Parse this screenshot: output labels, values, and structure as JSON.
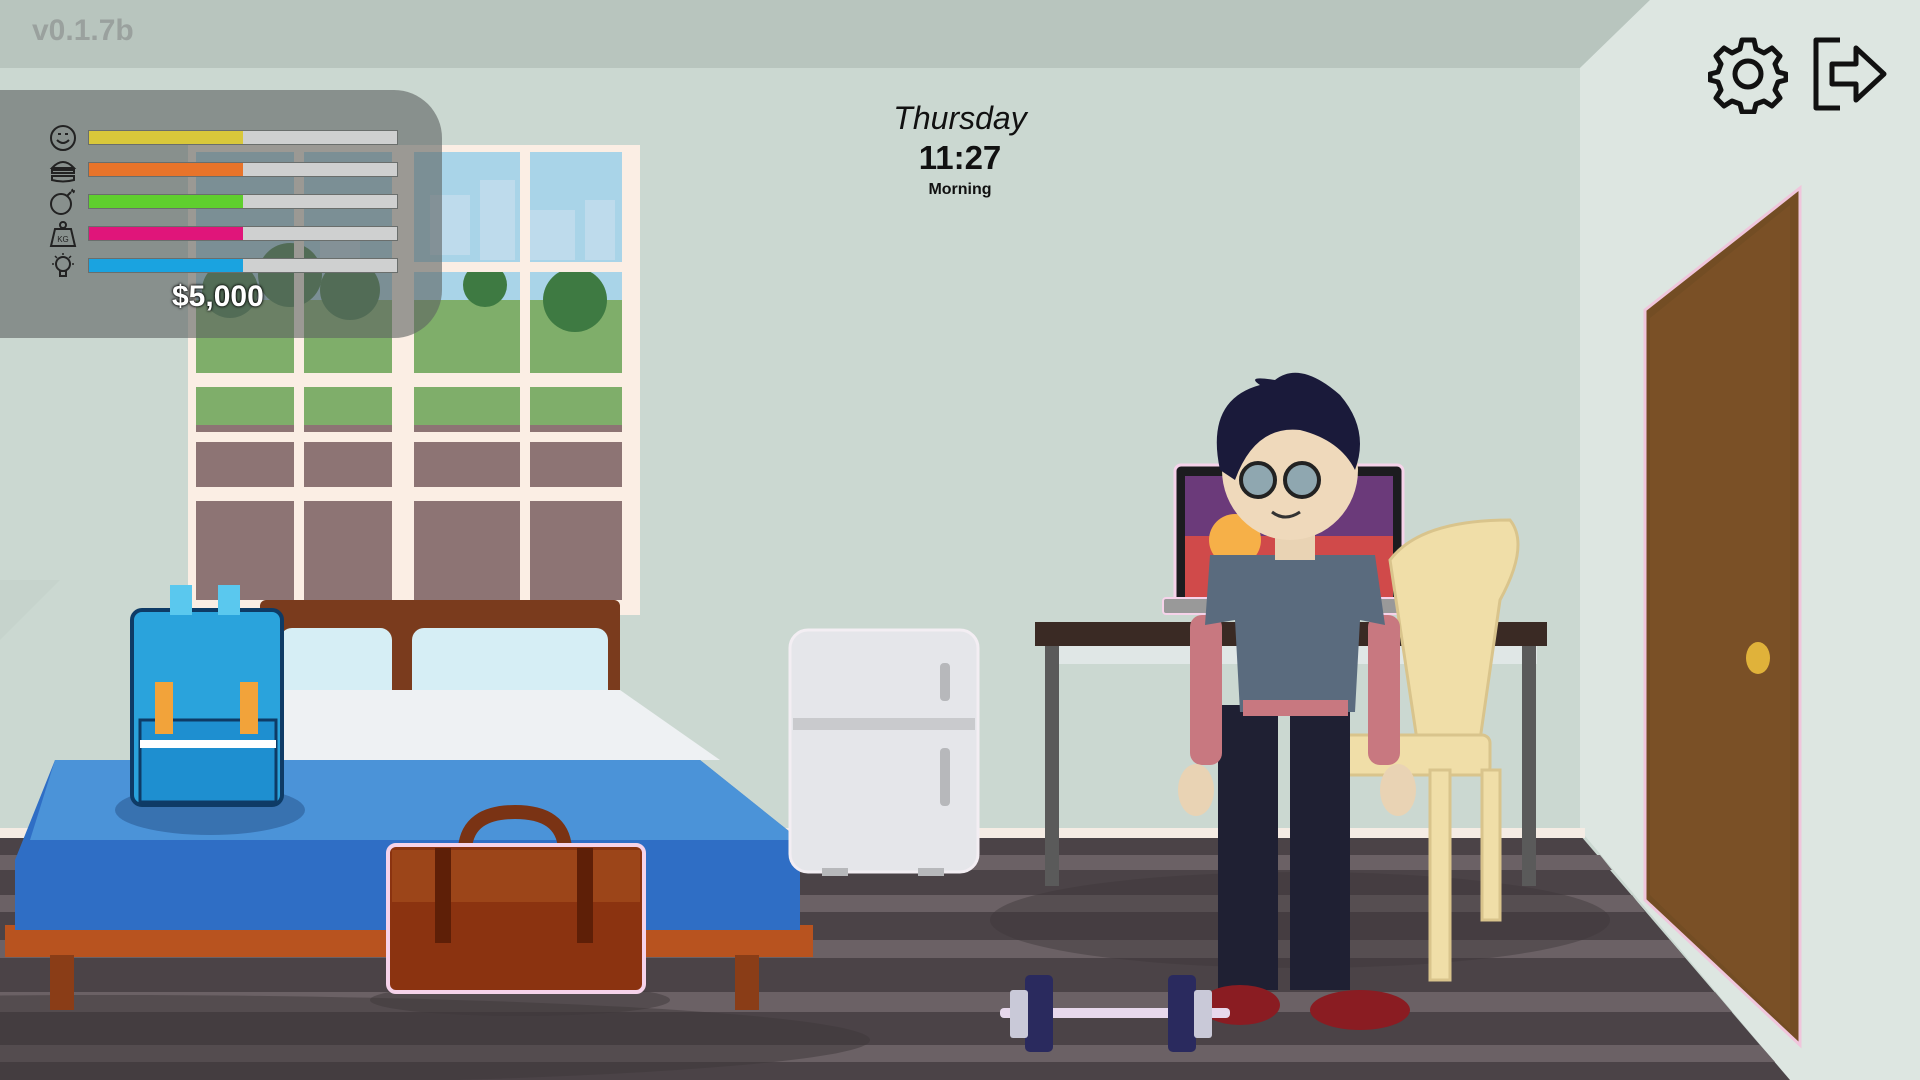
{
  "version": "v0.1.7b",
  "stats": [
    {
      "icon": "smiley-icon",
      "color": "#d9c83a",
      "value": 0.5
    },
    {
      "icon": "burger-icon",
      "color": "#e8742a",
      "value": 0.5
    },
    {
      "icon": "bomb-icon",
      "color": "#5fcf2e",
      "value": 0.5
    },
    {
      "icon": "weight-icon",
      "color": "#e0157a",
      "value": 0.5
    },
    {
      "icon": "lightbulb-icon",
      "color": "#1aa3e0",
      "value": 0.5
    }
  ],
  "weight_icon_label": "KG",
  "money": "$5,000",
  "clock": {
    "day": "Thursday",
    "time": "11:27",
    "period": "Morning"
  },
  "buttons": {
    "settings": "gear-icon",
    "exit": "exit-icon"
  }
}
